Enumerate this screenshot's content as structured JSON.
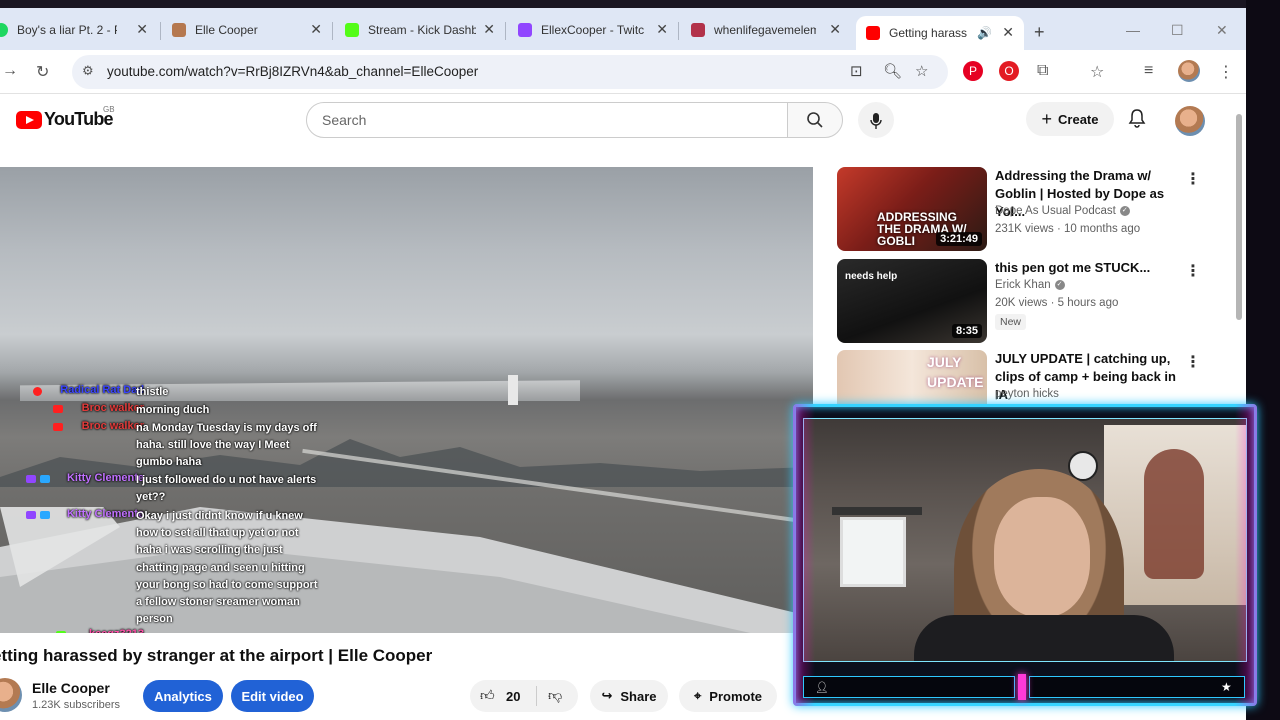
{
  "tabs": [
    {
      "title": "Boy's a liar Pt. 2 - P",
      "color": "#1ed760"
    },
    {
      "title": "Elle Cooper",
      "color": "#b5784f"
    },
    {
      "title": "Stream - Kick Dashb",
      "color": "#53fc18"
    },
    {
      "title": "EllexCooper - Twitc",
      "color": "#9146ff"
    },
    {
      "title": "whenlifegavemelem",
      "color": "#b2324a"
    },
    {
      "title": "Getting harass",
      "color": "#ff0000"
    }
  ],
  "address_bar": {
    "url": "youtube.com/watch?v=RrBj8IZRVn4&ab_channel=ElleCooper"
  },
  "youtube": {
    "logo_text": "YouTube",
    "country_code": "GB",
    "search_placeholder": "Search",
    "create_label": "Create"
  },
  "chat": [
    {
      "user": "",
      "text": "",
      "color": "#e23b3b"
    },
    {
      "user": "Radical Rat Dad",
      "text": "thistle",
      "color": "#3a44ff"
    },
    {
      "user": "Broc walker",
      "text": "morning duch",
      "color": "#e23b3b"
    },
    {
      "user": "Broc walker",
      "text": "na Monday Tuesday is my days off haha. still love the way I Meet gumbo haha",
      "color": "#e23b3b"
    },
    {
      "user": "Kitty Clemente",
      "text": "I just followed do u not have alerts yet??",
      "color": "#c070ff"
    },
    {
      "user": "Kitty Clemente",
      "text": "Okay i just didnt know if u knew how to set all that up yet or not haha i was scrolling the just chatting page and seen u hitting your bong so had to come support a fellow stoner sreamer woman person",
      "color": "#c070ff"
    },
    {
      "user": "keegz3213",
      "text": "",
      "color": "#ff4fa8"
    }
  ],
  "video": {
    "title": "etting harassed by stranger at the airport | Elle Cooper",
    "channel": "Elle Cooper",
    "subscribers": "1.23K subscribers",
    "analytics_label": "Analytics",
    "edit_label": "Edit video",
    "like_count": "20",
    "share_label": "Share",
    "promote_label": "Promote"
  },
  "recommendations": [
    {
      "title": "Addressing the Drama w/ Goblin | Hosted by Dope as Yol...",
      "channel": "Dope As Usual Podcast",
      "verified": true,
      "meta": "231K views · 10 months ago",
      "duration": "3:21:49",
      "badge": "",
      "thumb_text": "ADDRESSING THE DRAMA W/ GOBLI"
    },
    {
      "title": "this pen got me STUCK...",
      "channel": "Erick Khan",
      "verified": true,
      "meta": "20K views · 5 hours ago",
      "duration": "8:35",
      "badge": "New",
      "thumb_text": "needs help"
    },
    {
      "title": "JULY UPDATE | catching up, clips of camp + being back in IA",
      "channel": "peyton hicks",
      "verified": false,
      "meta": "",
      "duration": "",
      "badge": "",
      "thumb_text": "JULY UPDATE"
    }
  ]
}
